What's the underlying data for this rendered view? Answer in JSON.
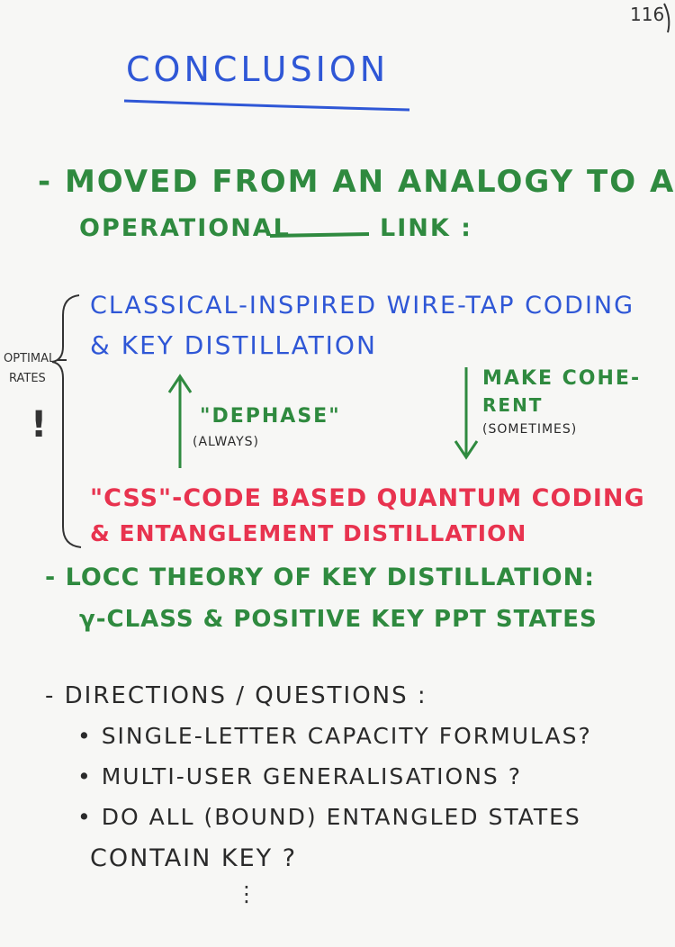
{
  "page_number": "116",
  "title": "CONCLUSION",
  "point1": {
    "line1": "- MOVED FROM AN ANALOGY TO AN",
    "line2": "OPERATIONAL",
    "line2b": "LINK :"
  },
  "classical": {
    "line1": "CLASSICAL-INSPIRED WIRE-TAP CODING",
    "line2": "& KEY DISTILLATION"
  },
  "side_label": {
    "line1": "OPTIMAL",
    "line2": "RATES",
    "mark": "!"
  },
  "dephase": {
    "label": "\"DEPHASE\"",
    "sub": "(ALWAYS)"
  },
  "coherent": {
    "line1": "MAKE COHE-",
    "line2": "RENT",
    "sub": "(SOMETIMES)"
  },
  "quantum": {
    "line1": "\"CSS\"-CODE BASED QUANTUM CODING",
    "line2": "& ENTANGLEMENT DISTILLATION"
  },
  "point2": {
    "line1": "- LOCC THEORY OF KEY DISTILLATION:",
    "line2": "γ-CLASS & POSITIVE KEY PPT STATES"
  },
  "point3": {
    "heading": "- DIRECTIONS / QUESTIONS :",
    "items": [
      "• SINGLE-LETTER CAPACITY FORMULAS?",
      "• MULTI-USER GENERALISATIONS ?",
      "• DO ALL (BOUND) ENTANGLED STATES",
      "CONTAIN KEY ?"
    ],
    "ellipsis": "⋮"
  },
  "colors": {
    "blue": "#2f57d6",
    "green": "#2f8a3f",
    "red": "#e8334f",
    "black": "#2a2a2a"
  }
}
